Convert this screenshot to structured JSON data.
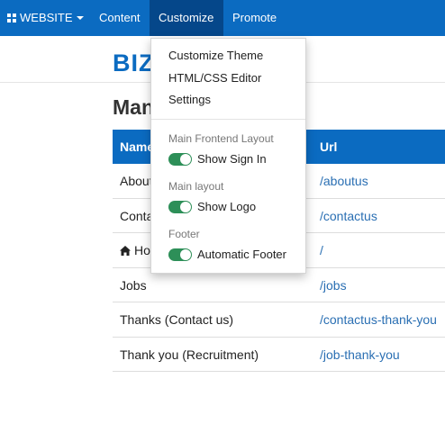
{
  "navbar": {
    "website_label": "WEBSITE",
    "content_label": "Content",
    "customize_label": "Customize",
    "promote_label": "Promote"
  },
  "site": {
    "logo_text": "BIZ"
  },
  "page": {
    "title": "Man"
  },
  "table": {
    "headers": {
      "name": "Name",
      "url": "Url"
    },
    "rows": [
      {
        "name": "About us",
        "url": "/aboutus"
      },
      {
        "name": "Contact us",
        "url": "/contactus"
      },
      {
        "name": "Home",
        "url": "/"
      },
      {
        "name": "Jobs",
        "url": "/jobs"
      },
      {
        "name": "Thanks (Contact us)",
        "url": "/contactus-thank-you"
      },
      {
        "name": "Thank you (Recruitment)",
        "url": "/job-thank-you"
      }
    ]
  },
  "dropdown": {
    "items": [
      "Customize Theme",
      "HTML/CSS Editor",
      "Settings"
    ],
    "sections": [
      {
        "header": "Main Frontend Layout",
        "toggle_label": "Show Sign In",
        "on": true
      },
      {
        "header": "Main layout",
        "toggle_label": "Show Logo",
        "on": true
      },
      {
        "header": "Footer",
        "toggle_label": "Automatic Footer",
        "on": true
      }
    ]
  },
  "colors": {
    "navbar": "#0b6bc1",
    "navbar_active": "#05478a",
    "link": "#2a6fb3",
    "toggle_on": "#2d8f58"
  }
}
